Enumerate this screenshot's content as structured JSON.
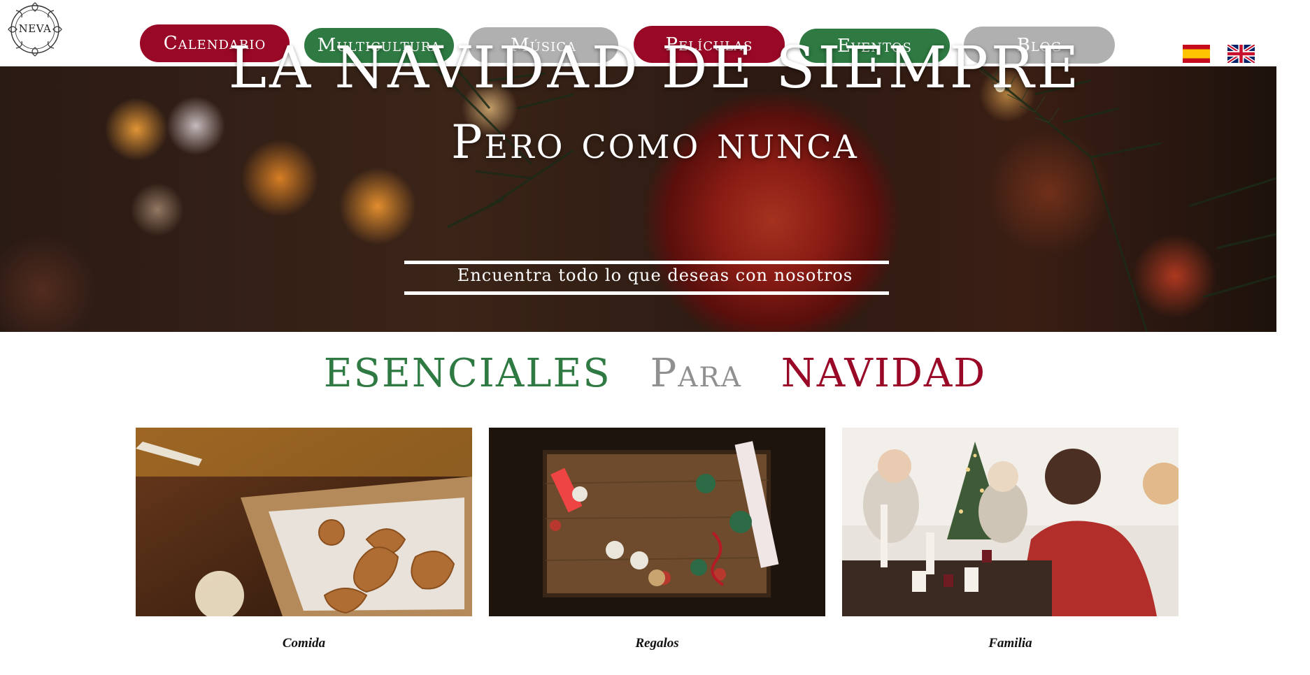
{
  "logo": {
    "text": "NEVA",
    "icon": "ornamental-circle-logo"
  },
  "nav": {
    "items": [
      {
        "label": "Calendario",
        "color": "#990826"
      },
      {
        "label": "Multicultura",
        "color": "#2e7a42"
      },
      {
        "label": "Música",
        "color": "#b0b0b0"
      },
      {
        "label": "Películas",
        "color": "#990826"
      },
      {
        "label": "Eventos",
        "color": "#2e7a42"
      },
      {
        "label": "Blog",
        "color": "#b0b0b0"
      }
    ]
  },
  "languages": [
    {
      "icon": "spain-flag-icon"
    },
    {
      "icon": "uk-flag-icon"
    }
  ],
  "hero": {
    "title_line1": "La Navidad de siempre",
    "title_line2": "Pero como nunca",
    "subtitle": "Encuentra todo lo que deseas con nosotros"
  },
  "section": {
    "word1": "Esenciales",
    "word2": "Para",
    "word3": "Navidad"
  },
  "cards": [
    {
      "caption": "Comida"
    },
    {
      "caption": "Regalos"
    },
    {
      "caption": "Familia"
    }
  ],
  "colors": {
    "brand_red": "#990826",
    "brand_green": "#2e7a42",
    "brand_grey": "#b0b0b0"
  }
}
